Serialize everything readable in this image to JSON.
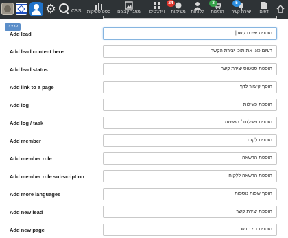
{
  "toolbar": {
    "css_label": "CSS",
    "nav": [
      {
        "name": "nav-statistics",
        "label": "סטטיסטיקות",
        "icon": "bar-chart-icon"
      },
      {
        "name": "nav-file-manager",
        "label": "מאגר קבצים",
        "icon": "image-icon"
      },
      {
        "name": "nav-widgets",
        "label": "ווידג'טים",
        "icon": "grid-icon"
      },
      {
        "name": "nav-tasks",
        "label": "משימות",
        "icon": "task-icon",
        "badge": "24",
        "badge_color": "#e0342c"
      },
      {
        "name": "nav-customers",
        "label": "לקוחות",
        "icon": "user-icon"
      },
      {
        "name": "nav-orders",
        "label": "הזמנות",
        "icon": "cart-icon",
        "badge": "3",
        "badge_color": "#36a24a"
      },
      {
        "name": "nav-contact-requests",
        "label": "יצירת קשר",
        "icon": "bell-icon",
        "badge": "5",
        "badge_color": "#2c8ee0"
      },
      {
        "name": "nav-pages",
        "label": "דפים",
        "icon": "page-icon"
      }
    ]
  },
  "edit_button_label": "עריכה",
  "rows": [
    {
      "label": "Add lead",
      "value": "הוספה יצירת קשר|"
    },
    {
      "label": "Add lead content here",
      "value": "רשום כאן את תוכן יצירת הקשר"
    },
    {
      "label": "Add lead status",
      "value": "הוספת סטטוס יצירת קשר"
    },
    {
      "label": "Add link to a page",
      "value": "הוסף קישור לדף"
    },
    {
      "label": "Add log",
      "value": "הוספת פעילות"
    },
    {
      "label": "Add log / task",
      "value": "הוספת פעילות / משימה"
    },
    {
      "label": "Add member",
      "value": "הוספת לקוח"
    },
    {
      "label": "Add member role",
      "value": "הוספת הרשאה"
    },
    {
      "label": "Add member role subscription",
      "value": "הוספת הרשאה ללקוח"
    },
    {
      "label": "Add more languages",
      "value": "הוסף שפות נוספות"
    },
    {
      "label": "Add new lead",
      "value": "הוספת יצירת קשר"
    },
    {
      "label": "Add new page",
      "value": "הוספת דף חדש"
    }
  ]
}
